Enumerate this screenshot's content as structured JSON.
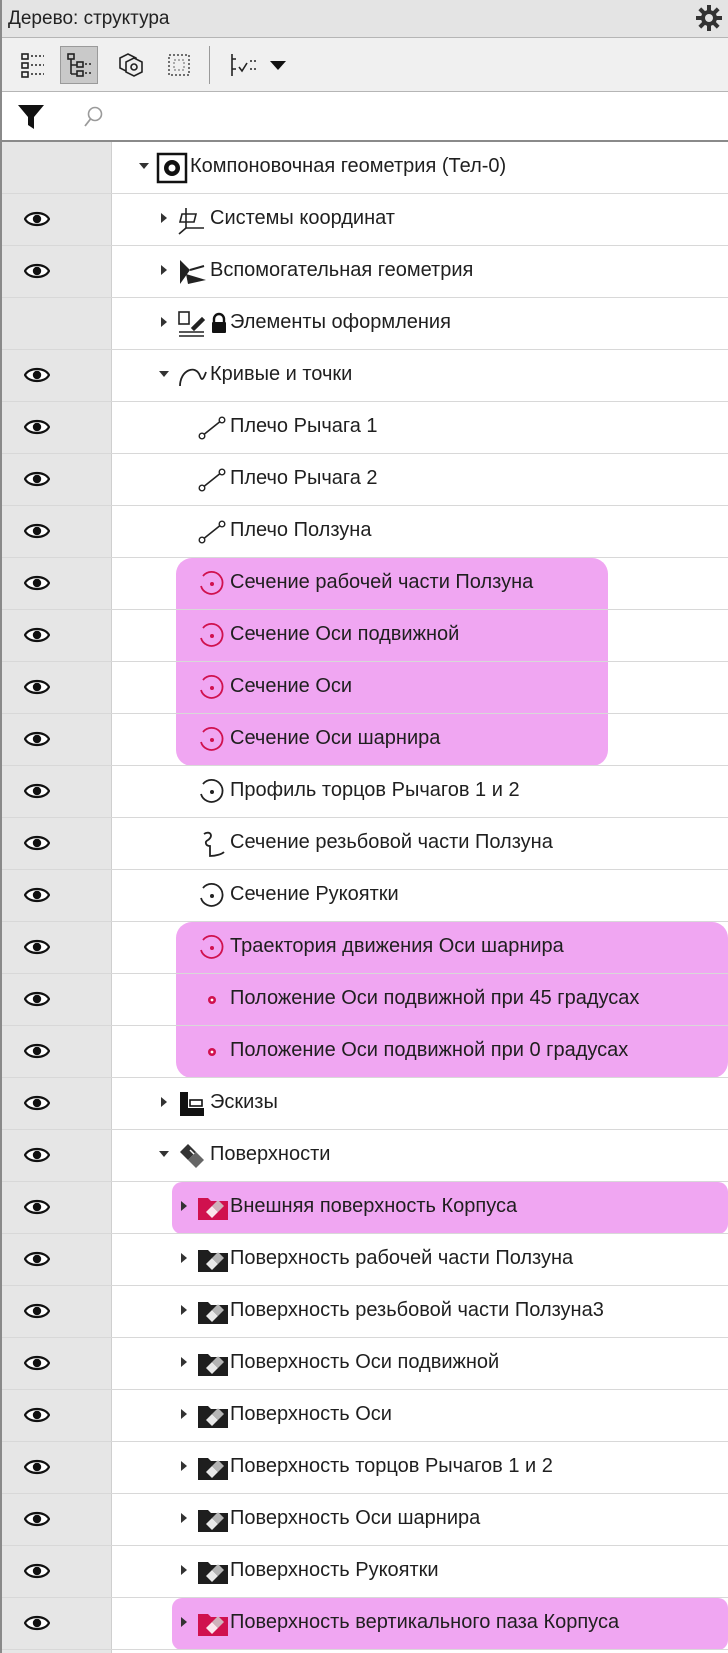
{
  "panel": {
    "title": "Дерево: структура"
  },
  "toolbar": {
    "buttons": [
      {
        "icon": "tree-flat-icon"
      },
      {
        "icon": "tree-structure-icon",
        "active": true
      },
      {
        "icon": "copy-geometry-icon"
      },
      {
        "icon": "select-frame-icon"
      },
      {
        "icon": "list-filter-icon"
      }
    ]
  },
  "filter": {
    "search_placeholder": ""
  },
  "colors": {
    "highlight": "#f0a6f2",
    "accent_red": "#d0114e",
    "visibility_column": "#e6e6e6"
  },
  "tree": {
    "rows": [
      {
        "label": "Компоновочная геометрия (Тел-0)",
        "level": 0,
        "arrow": "down",
        "icon": "layout-geometry-icon",
        "visible": false,
        "eye": false
      },
      {
        "label": "Системы координат",
        "level": 1,
        "arrow": "right",
        "icon": "coordinate-system-icon",
        "eye": true
      },
      {
        "label": "Вспомогательная геометрия",
        "level": 1,
        "arrow": "right",
        "icon": "auxiliary-geometry-icon",
        "eye": true
      },
      {
        "label": "Элементы оформления",
        "level": 1,
        "arrow": "right",
        "icon": "design-elements-icon",
        "locked": true,
        "eye": false
      },
      {
        "label": "Кривые и точки",
        "level": 1,
        "arrow": "down",
        "icon": "curves-points-icon",
        "eye": true
      },
      {
        "label": "Плечо Рычага 1",
        "level": 2,
        "icon": "segment-icon",
        "eye": true
      },
      {
        "label": "Плечо Рычага 2",
        "level": 2,
        "icon": "segment-icon",
        "eye": true
      },
      {
        "label": "Плечо Ползуна",
        "level": 2,
        "icon": "segment-icon",
        "eye": true
      },
      {
        "label": "Сечение рабочей части Ползуна",
        "level": 2,
        "icon": "section-circle-icon",
        "red": true,
        "eye": true
      },
      {
        "label": "Сечение Оси подвижной",
        "level": 2,
        "icon": "section-circle-icon",
        "red": true,
        "eye": true
      },
      {
        "label": "Сечение Оси",
        "level": 2,
        "icon": "section-circle-icon",
        "red": true,
        "eye": true
      },
      {
        "label": "Сечение Оси шарнира",
        "level": 2,
        "icon": "section-circle-icon",
        "red": true,
        "eye": true
      },
      {
        "label": "Профиль торцов Рычагов 1 и 2",
        "level": 2,
        "icon": "section-circle-icon",
        "eye": true
      },
      {
        "label": "Сечение резьбовой части Ползуна",
        "level": 2,
        "icon": "thread-section-icon",
        "eye": true
      },
      {
        "label": "Сечение Рукоятки",
        "level": 2,
        "icon": "section-circle-icon",
        "eye": true
      },
      {
        "label": "Траектория движения Оси шарнира",
        "level": 2,
        "icon": "section-circle-icon",
        "red": true,
        "eye": true
      },
      {
        "label": "Положение Оси подвижной при 45 градусах",
        "level": 2,
        "icon": "point-icon",
        "red": true,
        "eye": true
      },
      {
        "label": "Положение Оси подвижной при 0 градусах",
        "level": 2,
        "icon": "point-icon",
        "red": true,
        "eye": true
      },
      {
        "label": "Эскизы",
        "level": 1,
        "arrow": "right",
        "icon": "sketches-icon",
        "eye": true
      },
      {
        "label": "Поверхности",
        "level": 1,
        "arrow": "down",
        "icon": "surfaces-icon",
        "eye": true
      },
      {
        "label": "Внешняя поверхность Корпуса",
        "level": 2,
        "arrow": "right",
        "icon": "surface-folder-icon",
        "red": true,
        "eye": true
      },
      {
        "label": "Поверхность рабочей части Ползуна",
        "level": 2,
        "arrow": "right",
        "icon": "surface-folder-icon",
        "eye": true
      },
      {
        "label": "Поверхность резьбовой части Ползуна3",
        "level": 2,
        "arrow": "right",
        "icon": "surface-folder-icon",
        "eye": true
      },
      {
        "label": "Поверхность Оси подвижной",
        "level": 2,
        "arrow": "right",
        "icon": "surface-folder-icon",
        "eye": true
      },
      {
        "label": "Поверхность Оси",
        "level": 2,
        "arrow": "right",
        "icon": "surface-folder-icon",
        "eye": true
      },
      {
        "label": "Поверхность торцов Рычагов 1 и 2",
        "level": 2,
        "arrow": "right",
        "icon": "surface-folder-icon",
        "eye": true
      },
      {
        "label": "Поверхность Оси шарнира",
        "level": 2,
        "arrow": "right",
        "icon": "surface-folder-icon",
        "eye": true
      },
      {
        "label": "Поверхность Рукоятки",
        "level": 2,
        "arrow": "right",
        "icon": "surface-folder-icon",
        "eye": true
      },
      {
        "label": "Поверхность вертикального паза Корпуса",
        "level": 2,
        "arrow": "right",
        "icon": "surface-folder-icon",
        "red": true,
        "eye": true
      }
    ]
  }
}
